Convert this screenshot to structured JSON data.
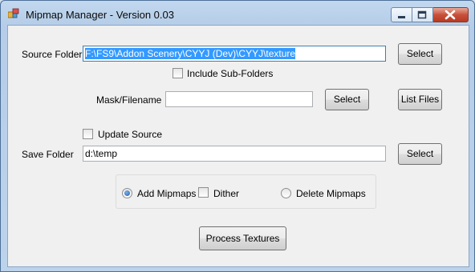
{
  "window": {
    "title": "Mipmap Manager - Version 0.03",
    "icons": {
      "app": "app-icon",
      "minimize": "minimize-icon",
      "maximize": "maximize-icon",
      "close": "close-icon"
    }
  },
  "form": {
    "source_folder_label": "Source Folder",
    "source_folder_value": "F:\\FS9\\Addon Scenery\\CYYJ (Dev)\\CYYJ\\texture",
    "source_select_label": "Select",
    "include_subfolders_label": "Include Sub-Folders",
    "include_subfolders_checked": false,
    "mask_label": "Mask/Filename",
    "mask_value": "",
    "mask_select_label": "Select",
    "list_files_label": "List Files",
    "update_source_label": "Update Source",
    "update_source_checked": false,
    "save_folder_label": "Save Folder",
    "save_folder_value": "d:\\temp",
    "save_select_label": "Select",
    "options": {
      "add_mipmaps_label": "Add Mipmaps",
      "add_mipmaps_selected": true,
      "dither_label": "Dither",
      "dither_checked": false,
      "delete_mipmaps_label": "Delete Mipmaps",
      "delete_mipmaps_selected": false
    },
    "process_label": "Process Textures"
  }
}
